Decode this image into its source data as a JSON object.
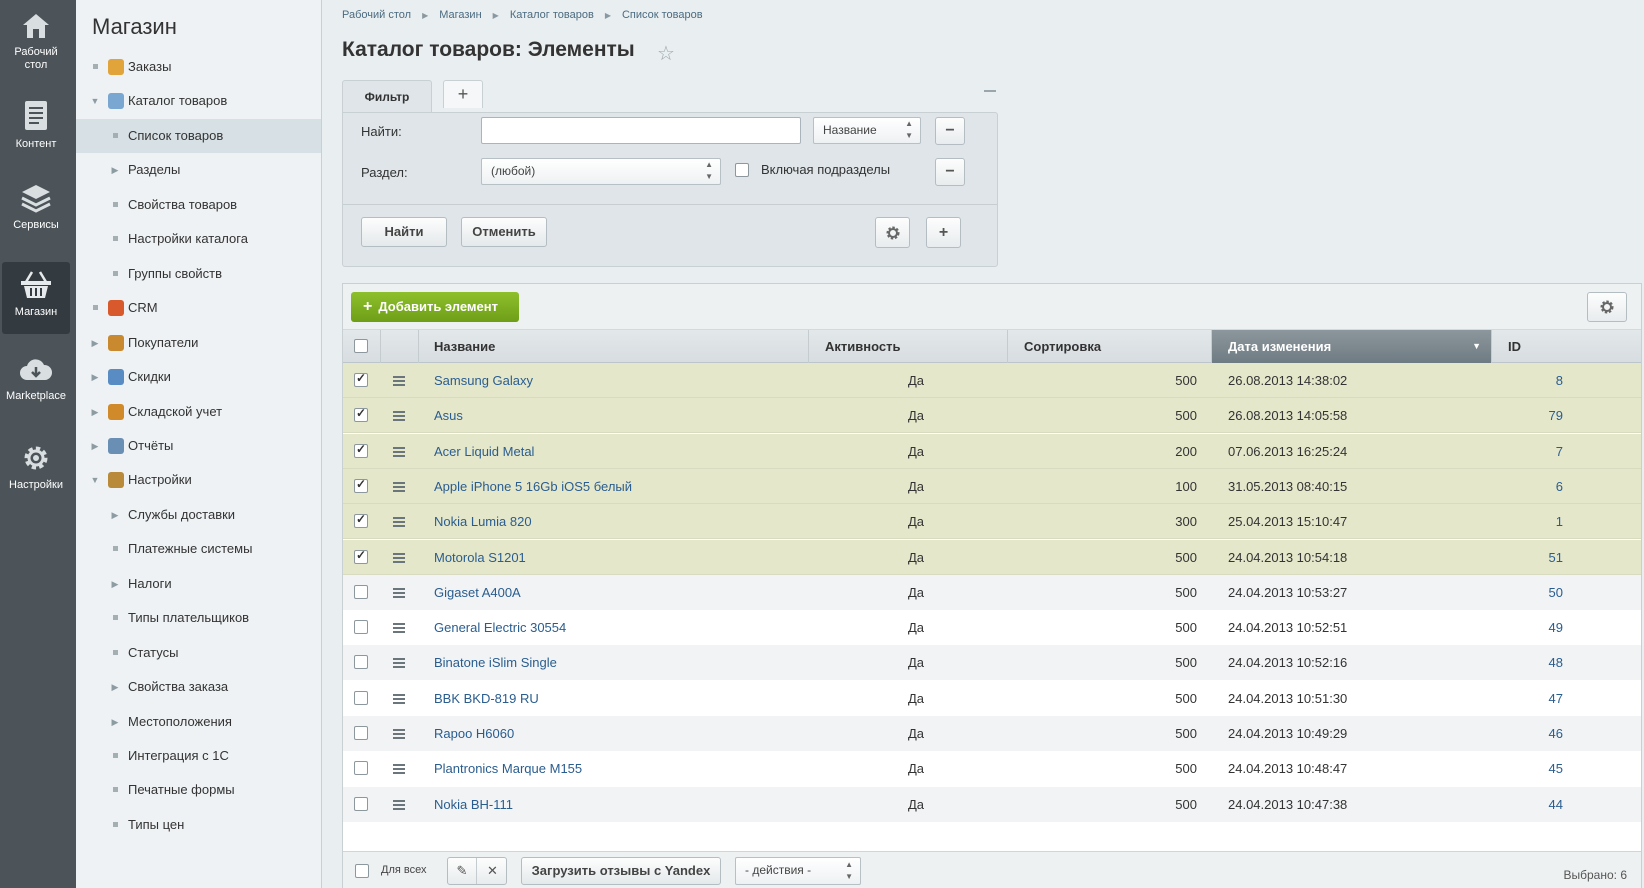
{
  "iconbar": {
    "items": [
      {
        "label": "Рабочий стол",
        "icon": "home-icon"
      },
      {
        "label": "Контент",
        "icon": "document-icon"
      },
      {
        "label": "Сервисы",
        "icon": "layers-icon"
      },
      {
        "label": "Магазин",
        "icon": "basket-icon",
        "active": true
      },
      {
        "label": "Marketplace",
        "icon": "cloud-download-icon"
      },
      {
        "label": "Настройки",
        "icon": "gear-icon"
      }
    ]
  },
  "menu": {
    "title": "Магазин",
    "items": [
      {
        "label": "Заказы",
        "marker": "bullet",
        "icon": "orders-icon"
      },
      {
        "label": "Каталог товаров",
        "marker": "expanded",
        "icon": "folder-icon"
      },
      {
        "label": "Список товаров",
        "marker": "bullet",
        "selected": true
      },
      {
        "label": "Разделы",
        "marker": "collapsed"
      },
      {
        "label": "Свойства товаров",
        "marker": "bullet"
      },
      {
        "label": "Настройки каталога",
        "marker": "bullet"
      },
      {
        "label": "Группы свойств",
        "marker": "bullet"
      },
      {
        "label": "CRM",
        "marker": "bullet",
        "icon": "crm-icon"
      },
      {
        "label": "Покупатели",
        "marker": "collapsed",
        "icon": "users-icon"
      },
      {
        "label": "Скидки",
        "marker": "collapsed",
        "icon": "discount-icon"
      },
      {
        "label": "Складской учет",
        "marker": "collapsed",
        "icon": "warehouse-icon"
      },
      {
        "label": "Отчёты",
        "marker": "collapsed",
        "icon": "reports-icon"
      },
      {
        "label": "Настройки",
        "marker": "expanded",
        "icon": "settings-icon"
      },
      {
        "label": "Службы доставки",
        "marker": "collapsed"
      },
      {
        "label": "Платежные системы",
        "marker": "bullet"
      },
      {
        "label": "Налоги",
        "marker": "collapsed"
      },
      {
        "label": "Типы плательщиков",
        "marker": "bullet"
      },
      {
        "label": "Статусы",
        "marker": "bullet"
      },
      {
        "label": "Свойства заказа",
        "marker": "collapsed"
      },
      {
        "label": "Местоположения",
        "marker": "collapsed"
      },
      {
        "label": "Интеграция с 1С",
        "marker": "bullet"
      },
      {
        "label": "Печатные формы",
        "marker": "bullet"
      },
      {
        "label": "Типы цен",
        "marker": "bullet"
      }
    ]
  },
  "breadcrumb": [
    "Рабочий стол",
    "Магазин",
    "Каталог товаров",
    "Список товаров"
  ],
  "page_title": "Каталог товаров: Элементы",
  "filter": {
    "tab_label": "Фильтр",
    "add_tab": "+",
    "find_label": "Найти:",
    "find_value": "",
    "find_field_select": "Название",
    "section_label": "Раздел:",
    "section_select": "(любой)",
    "include_subsections_label": "Включая подразделы",
    "find_button": "Найти",
    "cancel_button": "Отменить"
  },
  "grid": {
    "add_button": "Добавить элемент",
    "columns": [
      "Название",
      "Активность",
      "Сортировка",
      "Дата изменения",
      "ID"
    ],
    "sorted_column": "Дата изменения",
    "rows": [
      {
        "name": "Samsung Galaxy",
        "active": "Да",
        "sort": "500",
        "date": "26.08.2013 14:38:02",
        "id": "8",
        "checked": true
      },
      {
        "name": "Asus",
        "active": "Да",
        "sort": "500",
        "date": "26.08.2013 14:05:58",
        "id": "79",
        "checked": true
      },
      {
        "name": "Acer Liquid Metal",
        "active": "Да",
        "sort": "200",
        "date": "07.06.2013 16:25:24",
        "id": "7",
        "checked": true
      },
      {
        "name": "Apple iPhone 5 16Gb iOS5 белый",
        "active": "Да",
        "sort": "100",
        "date": "31.05.2013 08:40:15",
        "id": "6",
        "checked": true
      },
      {
        "name": "Nokia Lumia 820",
        "active": "Да",
        "sort": "300",
        "date": "25.04.2013 15:10:47",
        "id": "1",
        "checked": true
      },
      {
        "name": "Motorola S1201",
        "active": "Да",
        "sort": "500",
        "date": "24.04.2013 10:54:18",
        "id": "51",
        "checked": true
      },
      {
        "name": "Gigaset A400A",
        "active": "Да",
        "sort": "500",
        "date": "24.04.2013 10:53:27",
        "id": "50",
        "checked": false
      },
      {
        "name": "General Electric 30554",
        "active": "Да",
        "sort": "500",
        "date": "24.04.2013 10:52:51",
        "id": "49",
        "checked": false
      },
      {
        "name": "Binatone iSlim Single",
        "active": "Да",
        "sort": "500",
        "date": "24.04.2013 10:52:16",
        "id": "48",
        "checked": false
      },
      {
        "name": "BBK BKD-819 RU",
        "active": "Да",
        "sort": "500",
        "date": "24.04.2013 10:51:30",
        "id": "47",
        "checked": false
      },
      {
        "name": "Rapoo H6060",
        "active": "Да",
        "sort": "500",
        "date": "24.04.2013 10:49:29",
        "id": "46",
        "checked": false
      },
      {
        "name": "Plantronics Marque M155",
        "active": "Да",
        "sort": "500",
        "date": "24.04.2013 10:48:47",
        "id": "45",
        "checked": false
      },
      {
        "name": "Nokia BH-111",
        "active": "Да",
        "sort": "500",
        "date": "24.04.2013 10:47:38",
        "id": "44",
        "checked": false
      }
    ],
    "footer": {
      "for_all": "Для всех",
      "yandex_button": "Загрузить отзывы с Yandex",
      "actions_select": "- действия -",
      "selected_count": "Выбрано: 6"
    }
  },
  "colors": {
    "add_button": "#7fb021",
    "selected_row": "#e5e7cb",
    "link": "#2a5d8f"
  }
}
